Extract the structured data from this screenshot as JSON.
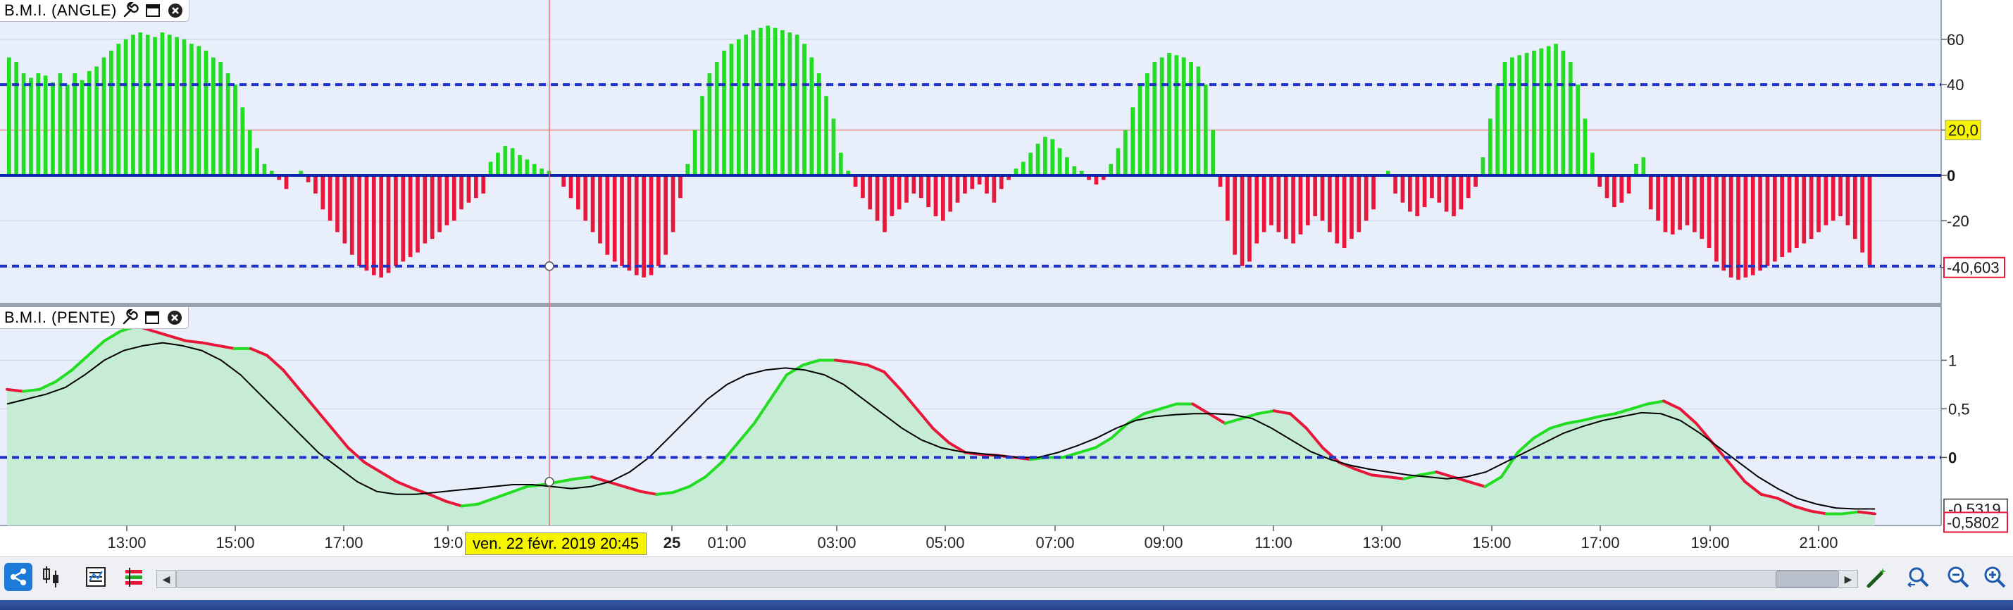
{
  "panels": {
    "angle": {
      "title": "B.M.I. (ANGLE)",
      "y_ticks": [
        "60",
        "40",
        "20,0",
        "0",
        "-20",
        "-40,603"
      ],
      "y_tick_values": [
        60,
        40,
        20,
        0,
        -20,
        -40.603
      ],
      "highlight_label": "20,0",
      "last_value_label": "-40,603",
      "ylim": [
        -50,
        68
      ],
      "levels": [
        40,
        0,
        -40
      ]
    },
    "pente": {
      "title": "B.M.I. (PENTE)",
      "y_ticks": [
        "1",
        "0,5",
        "0"
      ],
      "y_tick_values": [
        1,
        0.5,
        0
      ],
      "ma_label": "-0,5319",
      "last_value_label": "-0,5802",
      "ylim": [
        -0.7,
        1.3
      ]
    }
  },
  "x_axis": {
    "ticks": [
      "13:00",
      "15:00",
      "17:00",
      "19:0",
      "25",
      "01:00",
      "03:00",
      "05:00",
      "07:00",
      "09:00",
      "11:00",
      "13:00",
      "15:00",
      "17:00",
      "19:00",
      "21:00"
    ],
    "crosshair_label": "ven. 22 févr. 2019 20:45"
  },
  "toolbar": {
    "icons": [
      "share-icon",
      "candlestick-icon",
      "indicator-list-icon",
      "bars-config-icon"
    ],
    "right_icons": [
      "magic-wand-icon",
      "zoom-fit-icon",
      "zoom-out-icon",
      "zoom-in-icon"
    ]
  },
  "colors": {
    "positive": "#22dd22",
    "negative": "#e8173a",
    "level_line": "#1f33c8",
    "zero_line": "#0a28a8",
    "highlight_bg": "#f7f400",
    "red_label": "#e8173a",
    "area_fill": "#c6ecd6",
    "ma_line": "#000000"
  },
  "chart_data": [
    {
      "type": "bar",
      "title": "B.M.I. (ANGLE)",
      "ylim": [
        -50,
        68
      ],
      "grid": true,
      "reference_lines": [
        40,
        20,
        0,
        -40
      ],
      "values": [
        52,
        50,
        45,
        43,
        45,
        44,
        41,
        45,
        40,
        45,
        42,
        46,
        48,
        52,
        55,
        58,
        60,
        62,
        63,
        62,
        61,
        63,
        62,
        61,
        60,
        58,
        57,
        55,
        52,
        50,
        45,
        40,
        30,
        20,
        12,
        5,
        2,
        -2,
        -6,
        0,
        2,
        -3,
        -8,
        -15,
        -20,
        -25,
        -30,
        -35,
        -40,
        -42,
        -44,
        -45,
        -43,
        -40,
        -38,
        -36,
        -34,
        -30,
        -28,
        -25,
        -22,
        -20,
        -15,
        -12,
        -10,
        -8,
        6,
        10,
        13,
        12,
        9,
        7,
        5,
        3,
        2,
        0,
        -5,
        -10,
        -15,
        -20,
        -25,
        -30,
        -35,
        -38,
        -40,
        -42,
        -44,
        -45,
        -44,
        -40,
        -35,
        -25,
        -10,
        5,
        20,
        35,
        45,
        50,
        55,
        58,
        60,
        62,
        64,
        65,
        66,
        65,
        64,
        63,
        62,
        58,
        52,
        45,
        35,
        25,
        10,
        2,
        -5,
        -10,
        -15,
        -20,
        -25,
        -18,
        -15,
        -12,
        -8,
        -10,
        -14,
        -18,
        -20,
        -16,
        -12,
        -8,
        -6,
        -4,
        -8,
        -12,
        -6,
        -2,
        3,
        6,
        10,
        14,
        17,
        16,
        12,
        8,
        4,
        2,
        -2,
        -4,
        -2,
        5,
        12,
        20,
        30,
        40,
        45,
        50,
        52,
        54,
        53,
        52,
        50,
        48,
        40,
        20,
        -5,
        -20,
        -35,
        -40,
        -38,
        -30,
        -25,
        -22,
        -25,
        -28,
        -30,
        -26,
        -22,
        -18,
        -20,
        -25,
        -30,
        -32,
        -28,
        -25,
        -20,
        -15,
        0,
        2,
        -8,
        -12,
        -16,
        -18,
        -14,
        -10,
        -12,
        -16,
        -18,
        -15,
        -10,
        -5,
        8,
        25,
        40,
        50,
        52,
        53,
        54,
        55,
        56,
        57,
        58,
        55,
        50,
        40,
        25,
        10,
        -5,
        -10,
        -14,
        -12,
        -8,
        5,
        8,
        -15,
        -20,
        -25,
        -26,
        -24,
        -22,
        -25,
        -28,
        -32,
        -38,
        -42,
        -45,
        -46,
        -45,
        -44,
        -42,
        -40,
        -38,
        -36,
        -34,
        -32,
        -30,
        -28,
        -25,
        -22,
        -20,
        -18,
        -22,
        -28,
        -34,
        -40
      ]
    },
    {
      "type": "line",
      "title": "B.M.I. (PENTE)",
      "ylim": [
        -0.7,
        1.3
      ],
      "series": [
        {
          "values": [
            0.7,
            0.68,
            0.7,
            0.78,
            0.9,
            1.05,
            1.2,
            1.3,
            1.35,
            1.3,
            1.25,
            1.2,
            1.18,
            1.15,
            1.12,
            1.12,
            1.05,
            0.9,
            0.7,
            0.5,
            0.3,
            0.1,
            -0.05,
            -0.15,
            -0.25,
            -0.32,
            -0.38,
            -0.45,
            -0.5,
            -0.48,
            -0.42,
            -0.36,
            -0.3,
            -0.28,
            -0.25,
            -0.22,
            -0.2,
            -0.25,
            -0.3,
            -0.35,
            -0.38,
            -0.36,
            -0.3,
            -0.2,
            -0.05,
            0.15,
            0.35,
            0.6,
            0.85,
            0.95,
            1.0,
            1.0,
            0.98,
            0.95,
            0.88,
            0.7,
            0.5,
            0.3,
            0.15,
            0.05,
            0.03,
            0.02,
            0.0,
            -0.02,
            0.0,
            0.0,
            0.05,
            0.1,
            0.2,
            0.35,
            0.45,
            0.5,
            0.55,
            0.55,
            0.45,
            0.35,
            0.4,
            0.45,
            0.48,
            0.45,
            0.3,
            0.1,
            -0.05,
            -0.12,
            -0.18,
            -0.2,
            -0.22,
            -0.18,
            -0.15,
            -0.2,
            -0.25,
            -0.3,
            -0.2,
            0.05,
            0.2,
            0.3,
            0.35,
            0.38,
            0.42,
            0.45,
            0.5,
            0.55,
            0.58,
            0.5,
            0.35,
            0.15,
            -0.05,
            -0.25,
            -0.38,
            -0.42,
            -0.5,
            -0.55,
            -0.58,
            -0.58,
            -0.56,
            -0.58
          ]
        },
        {
          "values": [
            0.55,
            0.6,
            0.65,
            0.72,
            0.85,
            1.0,
            1.1,
            1.15,
            1.18,
            1.15,
            1.1,
            1.0,
            0.85,
            0.65,
            0.45,
            0.25,
            0.05,
            -0.1,
            -0.25,
            -0.35,
            -0.38,
            -0.38,
            -0.36,
            -0.34,
            -0.32,
            -0.3,
            -0.28,
            -0.28,
            -0.3,
            -0.32,
            -0.3,
            -0.25,
            -0.15,
            0.0,
            0.2,
            0.4,
            0.6,
            0.75,
            0.85,
            0.9,
            0.92,
            0.9,
            0.85,
            0.75,
            0.6,
            0.45,
            0.3,
            0.18,
            0.1,
            0.06,
            0.04,
            0.02,
            0.0,
            0.0,
            0.05,
            0.12,
            0.2,
            0.3,
            0.38,
            0.42,
            0.44,
            0.45,
            0.45,
            0.44,
            0.4,
            0.3,
            0.18,
            0.06,
            -0.02,
            -0.08,
            -0.12,
            -0.15,
            -0.18,
            -0.2,
            -0.22,
            -0.2,
            -0.15,
            -0.05,
            0.05,
            0.15,
            0.25,
            0.32,
            0.38,
            0.42,
            0.46,
            0.45,
            0.38,
            0.25,
            0.1,
            -0.05,
            -0.2,
            -0.32,
            -0.42,
            -0.48,
            -0.52,
            -0.53,
            -0.53
          ]
        }
      ]
    }
  ]
}
